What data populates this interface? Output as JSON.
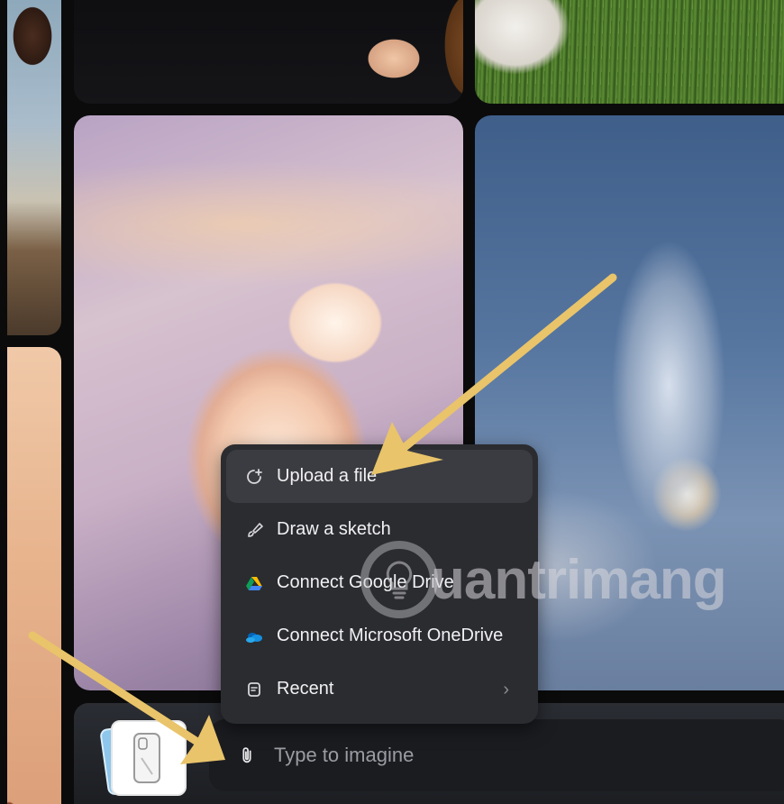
{
  "menu": {
    "items": [
      {
        "label": "Upload a file",
        "icon": "upload-file-icon"
      },
      {
        "label": "Draw a sketch",
        "icon": "brush-icon"
      },
      {
        "label": "Connect Google Drive",
        "icon": "google-drive-icon"
      },
      {
        "label": "Connect Microsoft OneDrive",
        "icon": "onedrive-icon"
      },
      {
        "label": "Recent",
        "icon": "recent-icon",
        "chevron": "›"
      }
    ]
  },
  "composer": {
    "placeholder": "Type to imagine",
    "attach_icon": "paperclip-icon"
  },
  "watermark": {
    "text": "uantrimang",
    "logo": "lightbulb-logo"
  },
  "colors": {
    "annotation_arrow": "#e9c46a",
    "menu_bg": "#2b2c30",
    "composer_bg": "#1b1c20"
  }
}
